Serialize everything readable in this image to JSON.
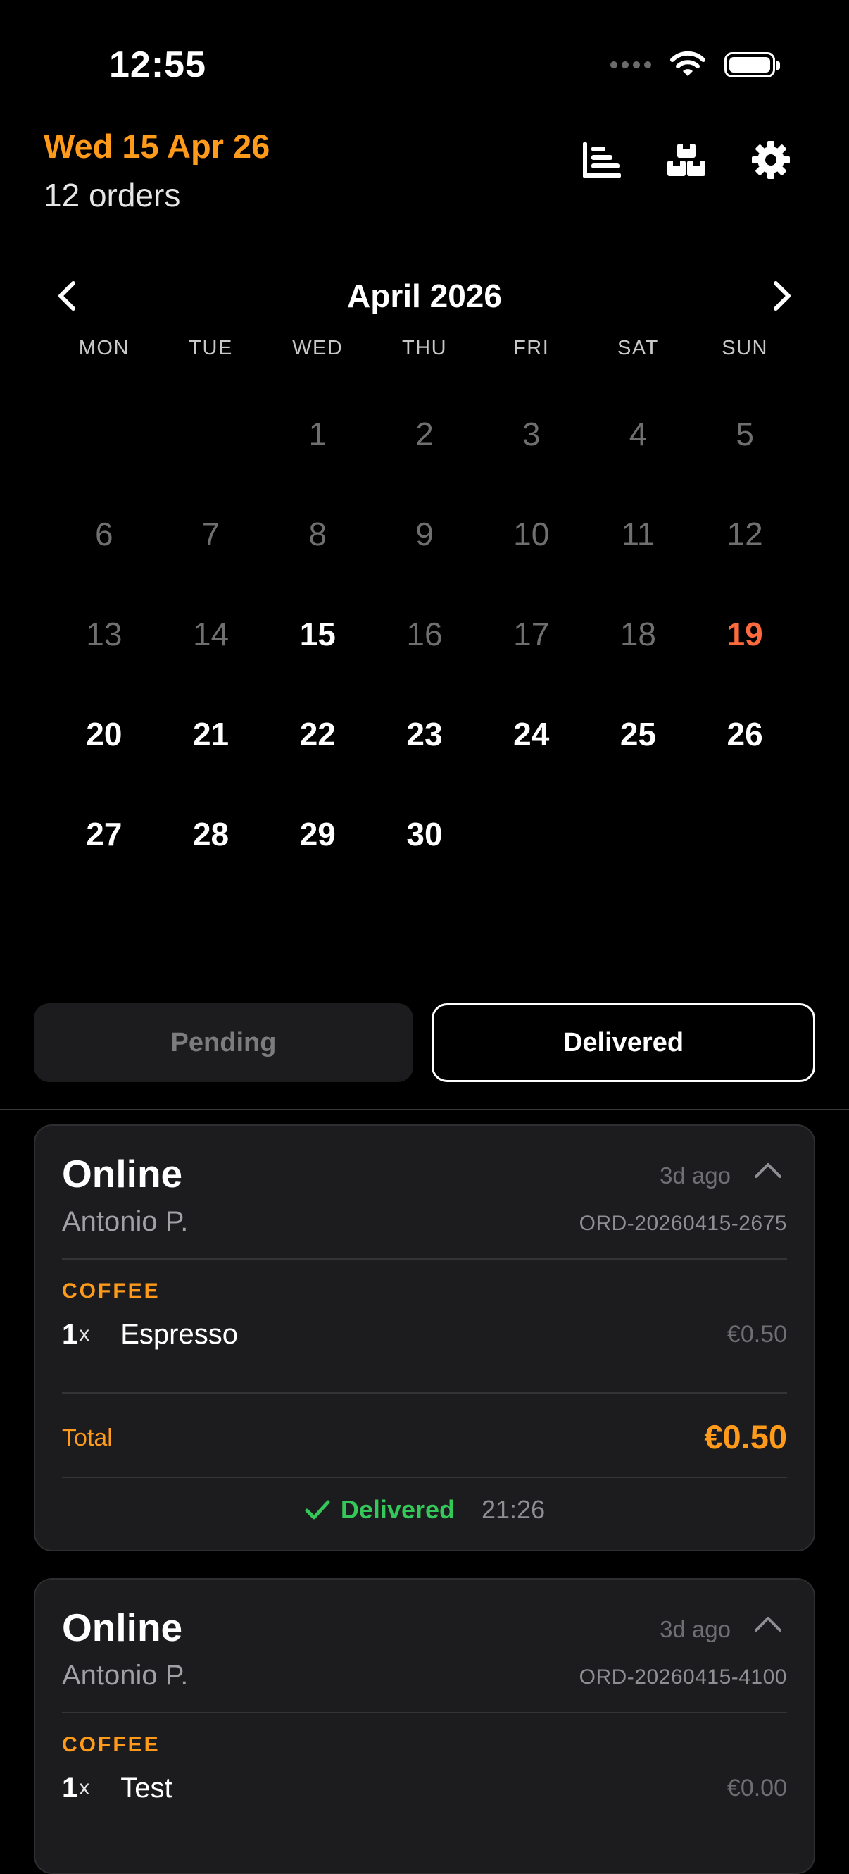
{
  "status_bar": {
    "time": "12:55"
  },
  "header": {
    "date": "Wed 15 Apr 26",
    "orders_count": "12 orders",
    "icons": [
      "chart-icon",
      "boxes-icon",
      "gear-icon"
    ]
  },
  "calendar": {
    "month_label": "April 2026",
    "weekdays": [
      "MON",
      "TUE",
      "WED",
      "THU",
      "FRI",
      "SAT",
      "SUN"
    ],
    "days": [
      "",
      "",
      "1",
      "2",
      "3",
      "4",
      "5",
      "6",
      "7",
      "8",
      "9",
      "10",
      "11",
      "12",
      "13",
      "14",
      "15",
      "16",
      "17",
      "18",
      "19",
      "20",
      "21",
      "22",
      "23",
      "24",
      "25",
      "26",
      "27",
      "28",
      "29",
      "30",
      "",
      "",
      ""
    ],
    "selected_day": "15",
    "today_day": "19"
  },
  "tabs": {
    "pending": "Pending",
    "delivered": "Delivered",
    "active": "Delivered"
  },
  "orders": [
    {
      "channel": "Online",
      "ago": "3d ago",
      "customer": "Antonio P.",
      "order_id": "ORD-20260415-2675",
      "category": "COFFEE",
      "item_qty": "1",
      "item_x": "x",
      "item_name": "Espresso",
      "item_price": "€0.50",
      "total_label": "Total",
      "total_value": "€0.50",
      "status": "Delivered",
      "status_time": "21:26"
    },
    {
      "channel": "Online",
      "ago": "3d ago",
      "customer": "Antonio P.",
      "order_id": "ORD-20260415-4100",
      "category": "COFFEE",
      "item_qty": "1",
      "item_x": "x",
      "item_name": "Test",
      "item_price": "€0.00"
    }
  ],
  "colors": {
    "accent": "#ff9a1a",
    "today": "#ff6a3d",
    "delivered": "#34c759",
    "card": "#1c1c1e"
  }
}
